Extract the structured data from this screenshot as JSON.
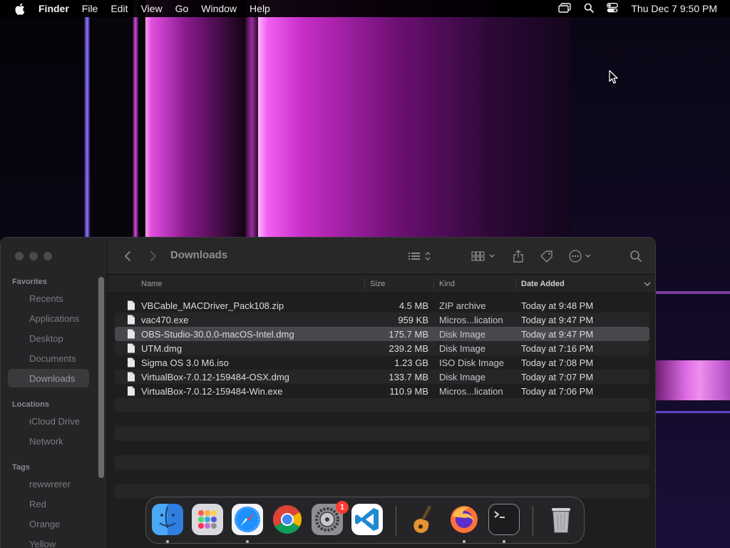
{
  "menubar": {
    "app_name": "Finder",
    "items": [
      "File",
      "Edit",
      "View",
      "Go",
      "Window",
      "Help"
    ],
    "clock": "Thu Dec 7  9:50 PM",
    "status_icons": [
      "screen-mirroring-icon",
      "spotlight-search-icon",
      "control-center-icon"
    ]
  },
  "finder": {
    "title": "Downloads",
    "sidebar": {
      "favorites_label": "Favorites",
      "favorites": [
        "Recents",
        "Applications",
        "Desktop",
        "Documents",
        "Downloads"
      ],
      "selected": "Downloads",
      "locations_label": "Locations",
      "locations": [
        "iCloud Drive",
        "Network"
      ],
      "tags_label": "Tags",
      "tags": [
        "rewwrerer",
        "Red",
        "Orange",
        "Yellow"
      ]
    },
    "toolbar_icons": [
      "back-icon",
      "forward-icon",
      "list-view-icon",
      "grid-view-icon",
      "share-icon",
      "tag-icon",
      "more-actions-icon",
      "search-icon"
    ],
    "columns": {
      "name": "Name",
      "size": "Size",
      "kind": "Kind",
      "date": "Date Added"
    },
    "sort_column": "Date Added",
    "files": [
      {
        "name": "VBCable_MACDriver_Pack108.zip",
        "size": "4.5 MB",
        "kind": "ZIP archive",
        "date": "Today at 9:48 PM"
      },
      {
        "name": "vac470.exe",
        "size": "959 KB",
        "kind": "Micros...lication",
        "date": "Today at 9:47 PM"
      },
      {
        "name": "OBS-Studio-30.0.0-macOS-Intel.dmg",
        "size": "175.7 MB",
        "kind": "Disk Image",
        "date": "Today at 9:47 PM"
      },
      {
        "name": "UTM.dmg",
        "size": "239.2 MB",
        "kind": "Disk Image",
        "date": "Today at 7:16 PM"
      },
      {
        "name": "Sigma OS 3.0 M6.iso",
        "size": "1.23 GB",
        "kind": "ISO Disk Image",
        "date": "Today at 7:08 PM"
      },
      {
        "name": "VirtualBox-7.0.12-159484-OSX.dmg",
        "size": "133.7 MB",
        "kind": "Disk Image",
        "date": "Today at 7:07 PM"
      },
      {
        "name": "VirtualBox-7.0.12-159484-Win.exe",
        "size": "110.9 MB",
        "kind": "Micros...lication",
        "date": "Today at 7:06 PM"
      }
    ],
    "selected_file": "OBS-Studio-30.0.0-macOS-Intel.dmg"
  },
  "dock": {
    "apps": [
      "finder-icon",
      "launchpad-icon",
      "safari-icon",
      "chrome-icon",
      "system-settings-icon",
      "vscode-icon",
      "garageband-icon",
      "firefox-icon",
      "terminal-icon",
      "trash-icon"
    ],
    "settings_badge": "1"
  },
  "colors": {
    "window_bg": "#1e1e1e",
    "selection": "#48484c",
    "badge": "#ff3b30"
  }
}
